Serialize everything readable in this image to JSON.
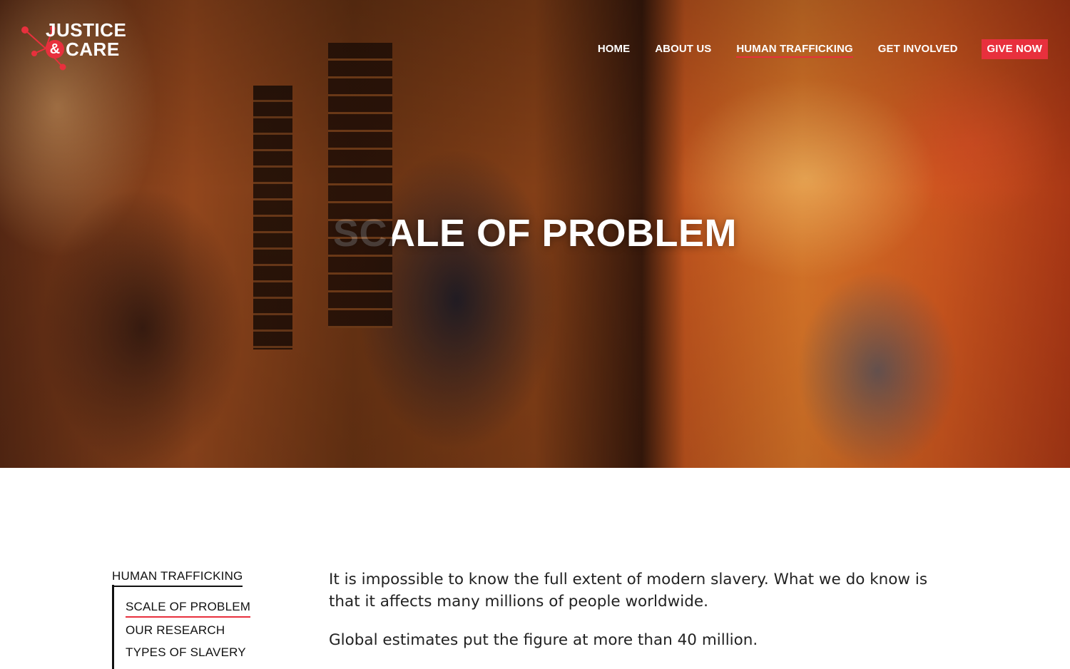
{
  "logo": {
    "line1": "JUSTICE",
    "amp": "&",
    "line2": "CARE",
    "accent": "#e8303d"
  },
  "nav": {
    "items": [
      {
        "label": "HOME",
        "active": false
      },
      {
        "label": "ABOUT US",
        "active": false
      },
      {
        "label": "HUMAN TRAFFICKING",
        "active": true
      },
      {
        "label": "GET INVOLVED",
        "active": false
      }
    ],
    "cta": "GIVE NOW"
  },
  "hero": {
    "title": "SCALE OF PROBLEM"
  },
  "sidebar": {
    "heading": "HUMAN TRAFFICKING",
    "items": [
      {
        "label": "SCALE OF PROBLEM",
        "active": true
      },
      {
        "label": "OUR RESEARCH",
        "active": false
      },
      {
        "label": "TYPES OF SLAVERY",
        "active": false
      }
    ]
  },
  "content": {
    "paragraphs": [
      "It is impossible to know the full extent of modern slavery. What we do know is that it affects many millions of people worldwide.",
      "Global estimates put the figure at more than 40 million."
    ]
  }
}
